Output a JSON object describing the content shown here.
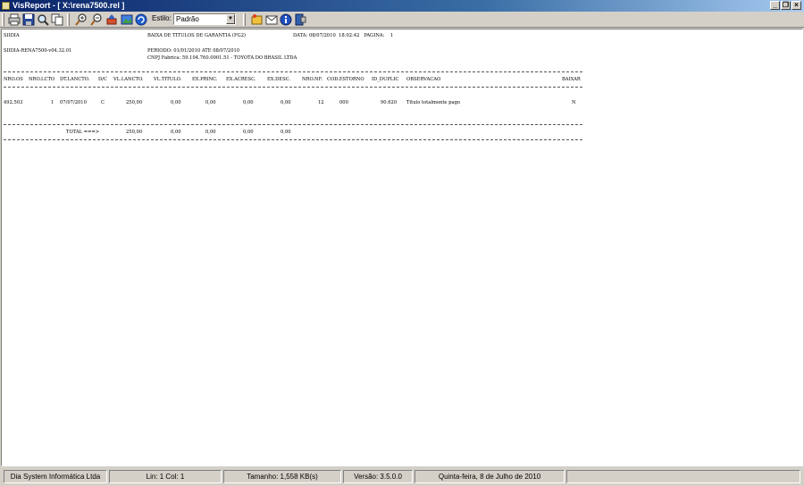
{
  "window": {
    "title": "VisReport - [ X:\\rena7500.rel ]",
    "minimize_label": "_",
    "restore_label": "❐",
    "close_label": "×"
  },
  "toolbar": {
    "style_label": "Estilo:",
    "style_value": "Padrão",
    "icons": [
      "print-icon",
      "save-icon",
      "preview-icon",
      "copy-icon",
      "zoom-in-icon",
      "zoom-out-icon",
      "export-icon",
      "image-icon",
      "refresh-icon",
      "open-icon",
      "email-icon",
      "info-icon",
      "exit-icon"
    ]
  },
  "report": {
    "company": "SIIDIA",
    "program": "SIIDIA-RENA7500-v04.32.01",
    "title": "BAIXA DE TITULOS DE GARANTIA (FG2)",
    "date_line": "DATA: 08/07/2010  18:02:42   PAGINA:    1",
    "period": "PERIODO: 01/01/2010 ATE 08/07/2010",
    "cnpj": "CNPJ Fabrica: 59.104.760.0001.51 - TOYOTA DO BRASIL LTDA",
    "columns": {
      "nro_os": "NRO.OS",
      "nro_lcto": "NRO.LCTO",
      "dt_lancto": "DT.LANCTO.",
      "dc": "D/C",
      "vl_lancto": "VL.LANCTO.",
      "vl_titulo": "VL.TITULO.",
      "ex_princ": "EX.PRINC.",
      "ex_acresc": "EX.ACRESC.",
      "ex_desc": "EX.DESC.",
      "nro_nf": "NRO.NF.",
      "cod_estorno": "COD.ESTORNO",
      "id_duplic": "ID_DUPLIC",
      "observacao": "OBSERVACAO",
      "baixar": "BAIXAR"
    },
    "row": {
      "nro_os": "492.503",
      "nro_lcto": "1",
      "dt_lancto": "07/07/2010",
      "dc": "C",
      "vl_lancto": "250,00",
      "vl_titulo": "0,00",
      "ex_princ": "0,00",
      "ex_acresc": "0,00",
      "ex_desc": "0,00",
      "nro_nf": "12",
      "cod_estorno": "000",
      "id_duplic": "90.620",
      "observacao": "Titulo totalmente pago",
      "baixar": "N"
    },
    "total": {
      "label": "TOTAL ===>",
      "vl_lancto": "250,00",
      "vl_titulo": "0,00",
      "ex_princ": "0,00",
      "ex_acresc": "0,00",
      "ex_desc": "0,00"
    }
  },
  "status": {
    "company": "Dia System Informática Ltda",
    "position": "Lin:  1  Col:  1",
    "size": "Tamanho: 1,558 KB(s)",
    "version": "Versão: 3.5.0.0",
    "date": "Quinta-feira, 8 de Julho de 2010"
  }
}
